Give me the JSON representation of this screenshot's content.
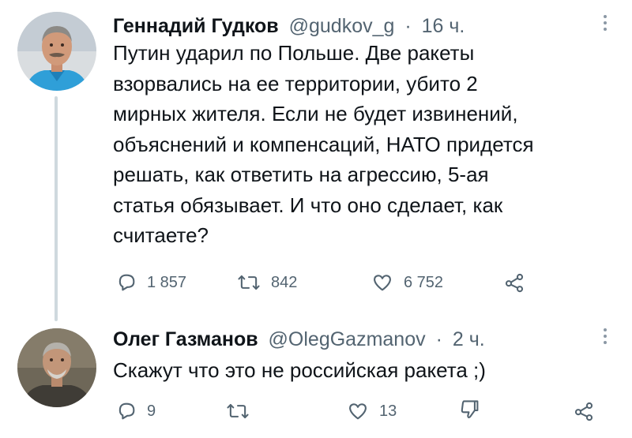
{
  "tweet1": {
    "display_name": "Геннадий Гудков",
    "handle": "@gudkov_g",
    "separator": "·",
    "time": "16 ч.",
    "text": "Путин ударил по Польше. Две ракеты\nвзорвались на ее территории, убито 2\nмирных жителя. Если не будет извинений,\nобъяснений и компенсаций, НАТО придется\nрешать, как ответить на агрессию, 5-ая\nстатья обязывает. И что оно сделает, как\nсчитаете?",
    "replies": "1 857",
    "retweets": "842",
    "likes": "6 752",
    "icons": {
      "reply": "reply-icon",
      "retweet": "retweet-icon",
      "like": "like-icon",
      "share": "share-icon",
      "more": "more-icon"
    }
  },
  "tweet2": {
    "display_name": "Олег Газманов",
    "handle": "@OlegGazmanov",
    "separator": "·",
    "time": "2 ч.",
    "text": "Скажут что это не российская ракета ;)",
    "replies": "9",
    "likes": "13",
    "icons": {
      "reply": "reply-icon",
      "retweet": "retweet-icon",
      "like": "like-icon",
      "dislike": "thumbs-down-icon",
      "share": "share-icon",
      "more": "more-icon"
    }
  },
  "colors": {
    "text": "#0f1419",
    "secondary": "#536471",
    "thread_line": "#cfd9de"
  }
}
